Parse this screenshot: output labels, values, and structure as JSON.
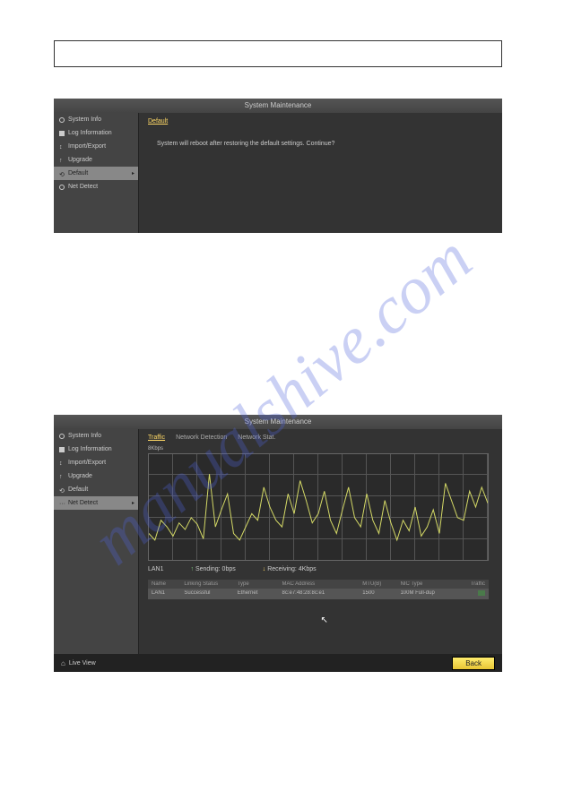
{
  "watermark": "manualshive.com",
  "panel1": {
    "title": "System Maintenance",
    "sidebar": {
      "items": [
        {
          "label": "System Info"
        },
        {
          "label": "Log Information"
        },
        {
          "label": "Import/Export"
        },
        {
          "label": "Upgrade"
        },
        {
          "label": "Default"
        },
        {
          "label": "Net Detect"
        }
      ]
    },
    "heading": "Default",
    "message": "System will reboot after restoring the default settings. Continue?"
  },
  "panel2": {
    "title": "System Maintenance",
    "sidebar": {
      "items": [
        {
          "label": "System Info"
        },
        {
          "label": "Log Information"
        },
        {
          "label": "Import/Export"
        },
        {
          "label": "Upgrade"
        },
        {
          "label": "Default"
        },
        {
          "label": "Net Detect"
        }
      ]
    },
    "tabs": [
      {
        "label": "Traffic"
      },
      {
        "label": "Network Detection"
      },
      {
        "label": "Network Stat."
      }
    ],
    "bps_label": "8Kbps",
    "lan_label": "LAN1",
    "sending_label": "Sending: 0bps",
    "receiving_label": "Receiving: 4Kbps",
    "table": {
      "headers": {
        "name": "Name",
        "link": "Linking Status",
        "type": "Type",
        "mac": "MAC Address",
        "mtu": "MTU(B)",
        "nic": "NIC Type",
        "traffic": "Traffic"
      },
      "rows": [
        {
          "name": "LAN1",
          "link": "Successful",
          "type": "Ethernet",
          "mac": "8c:e7:48:28:8c:e1",
          "mtu": "1500",
          "nic": "100M Full-dup"
        }
      ]
    },
    "live_view": "Live View",
    "back": "Back"
  },
  "chart_data": {
    "type": "line",
    "title": "",
    "xlabel": "",
    "ylabel": "",
    "ylim": [
      0,
      8
    ],
    "y_unit": "Kbps",
    "series": [
      {
        "name": "Receiving",
        "values": [
          2.0,
          1.5,
          3.0,
          2.5,
          1.8,
          2.8,
          2.3,
          3.2,
          2.7,
          1.6,
          6.5,
          2.5,
          3.8,
          5.0,
          2.0,
          1.5,
          2.5,
          3.5,
          3.0,
          5.5,
          4.0,
          3.0,
          2.5,
          5.0,
          3.5,
          6.0,
          4.5,
          2.8,
          3.5,
          5.2,
          3.0,
          2.0,
          3.8,
          5.5,
          3.2,
          2.5,
          5.0,
          3.0,
          2.0,
          4.5,
          2.8,
          1.5,
          3.0,
          2.2,
          4.0,
          1.8,
          2.5,
          3.8,
          2.0,
          5.8,
          4.5,
          3.2,
          3.0,
          5.2,
          4.0,
          5.5,
          4.3
        ]
      }
    ]
  }
}
